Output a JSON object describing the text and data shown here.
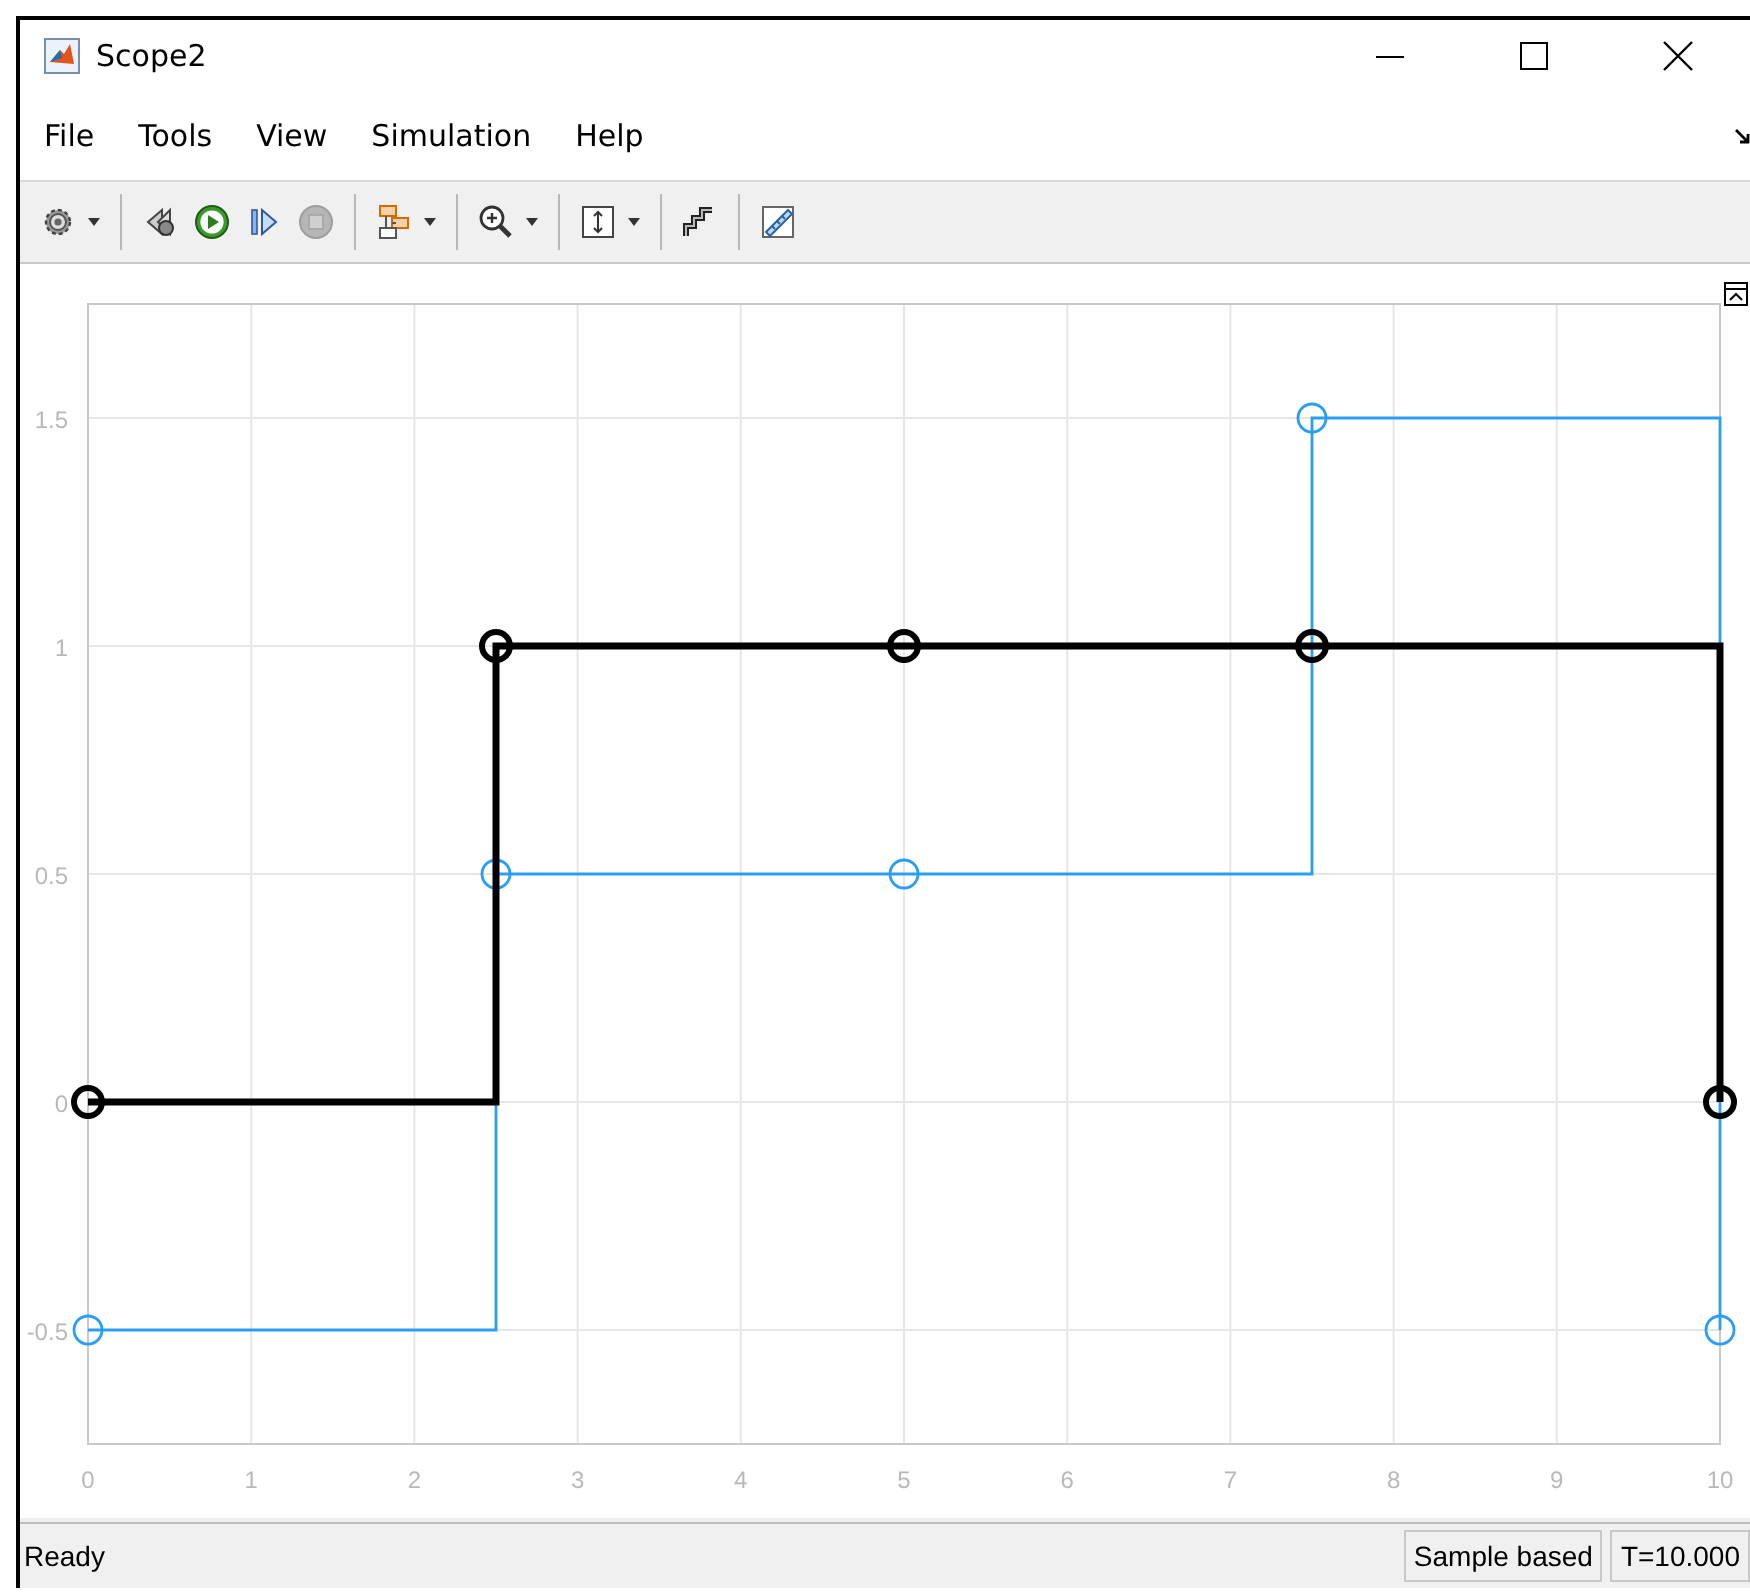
{
  "window": {
    "title": "Scope2"
  },
  "menu": [
    {
      "label": "File"
    },
    {
      "label": "Tools"
    },
    {
      "label": "View"
    },
    {
      "label": "Simulation"
    },
    {
      "label": "Help"
    }
  ],
  "toolbar": [
    {
      "kind": "settings",
      "dropdown": true
    },
    {
      "kind": "separator"
    },
    {
      "kind": "step-back",
      "dropdown": false
    },
    {
      "kind": "run",
      "dropdown": false
    },
    {
      "kind": "step-forward",
      "dropdown": false
    },
    {
      "kind": "stop",
      "dropdown": false,
      "disabled": true
    },
    {
      "kind": "separator"
    },
    {
      "kind": "layout",
      "dropdown": true
    },
    {
      "kind": "separator"
    },
    {
      "kind": "zoom",
      "dropdown": true
    },
    {
      "kind": "separator"
    },
    {
      "kind": "scale",
      "dropdown": true
    },
    {
      "kind": "separator"
    },
    {
      "kind": "stairs",
      "dropdown": false
    },
    {
      "kind": "separator"
    },
    {
      "kind": "ruler",
      "dropdown": false
    }
  ],
  "plot": {
    "chart_data": {
      "type": "line",
      "x": [
        0,
        2.5,
        2.5,
        5,
        7.5,
        7.5,
        10,
        10
      ],
      "grid": true,
      "series": [
        {
          "color": "#000000",
          "marker": "o",
          "values": [
            0,
            0,
            1,
            1,
            1,
            1,
            1,
            0
          ]
        },
        {
          "color": "#2a9df4",
          "marker": "o",
          "values": [
            -0.5,
            -0.5,
            0.5,
            0.5,
            0.5,
            1.5,
            1.5,
            -0.5
          ]
        }
      ],
      "xlim": [
        0,
        10
      ],
      "ylim": [
        -0.75,
        1.75
      ],
      "xticks": [
        0,
        1,
        2,
        3,
        4,
        5,
        6,
        7,
        8,
        9,
        10
      ],
      "yticks": [
        -0.5,
        0,
        0.5,
        1,
        1.5
      ]
    }
  },
  "status_bar": {
    "message": "Ready",
    "mode": "Sample based",
    "time": "T=10.000"
  }
}
